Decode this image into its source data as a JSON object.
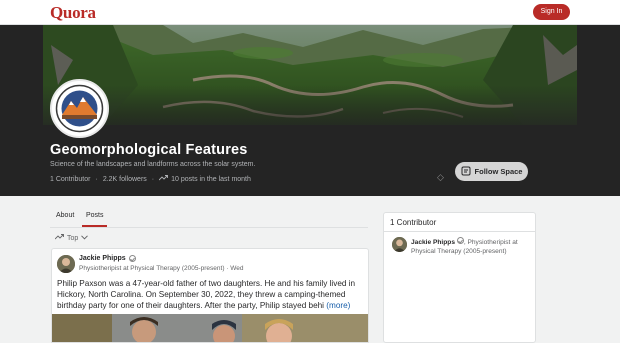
{
  "header": {
    "logo": "Quora",
    "sign_in_label": "Sign In"
  },
  "space": {
    "title": "Geomorphological Features",
    "description": "Science of the landscapes and landforms across the solar system.",
    "contributors": "1 Contributor",
    "followers": "2.2K followers",
    "posts_activity": "10 posts in the last month",
    "follow_label": "Follow Space"
  },
  "tabs": {
    "about": "About",
    "posts": "Posts",
    "sort_label": "Top"
  },
  "post": {
    "author": "Jackie Phipps",
    "credential": "Physiotheripist at Physical Therapy (2005-present)",
    "separator": "·",
    "date": "Wed",
    "line1": "Philip Paxson was a 47-year-old father of two daughters. He and his family lived in",
    "line2": "Hickory, North Carolina. On September 30, 2022, they threw a camping-themed",
    "line3": "birthday party for one of their daughters. After the party, Philip stayed behi",
    "more_label": "(more)"
  },
  "sidebar": {
    "heading": "1 Contributor",
    "contributor_name": "Jackie Phipps",
    "contributor_credential": ", Physiotheripist at Physical Therapy (2005-present)"
  },
  "colors": {
    "brand": "#b92b27",
    "hero_background": "#242424",
    "link": "#195faa"
  },
  "icons": [
    "verified-icon",
    "trending-icon",
    "follow-space-icon",
    "chevron-down-icon",
    "diamond-icon"
  ]
}
